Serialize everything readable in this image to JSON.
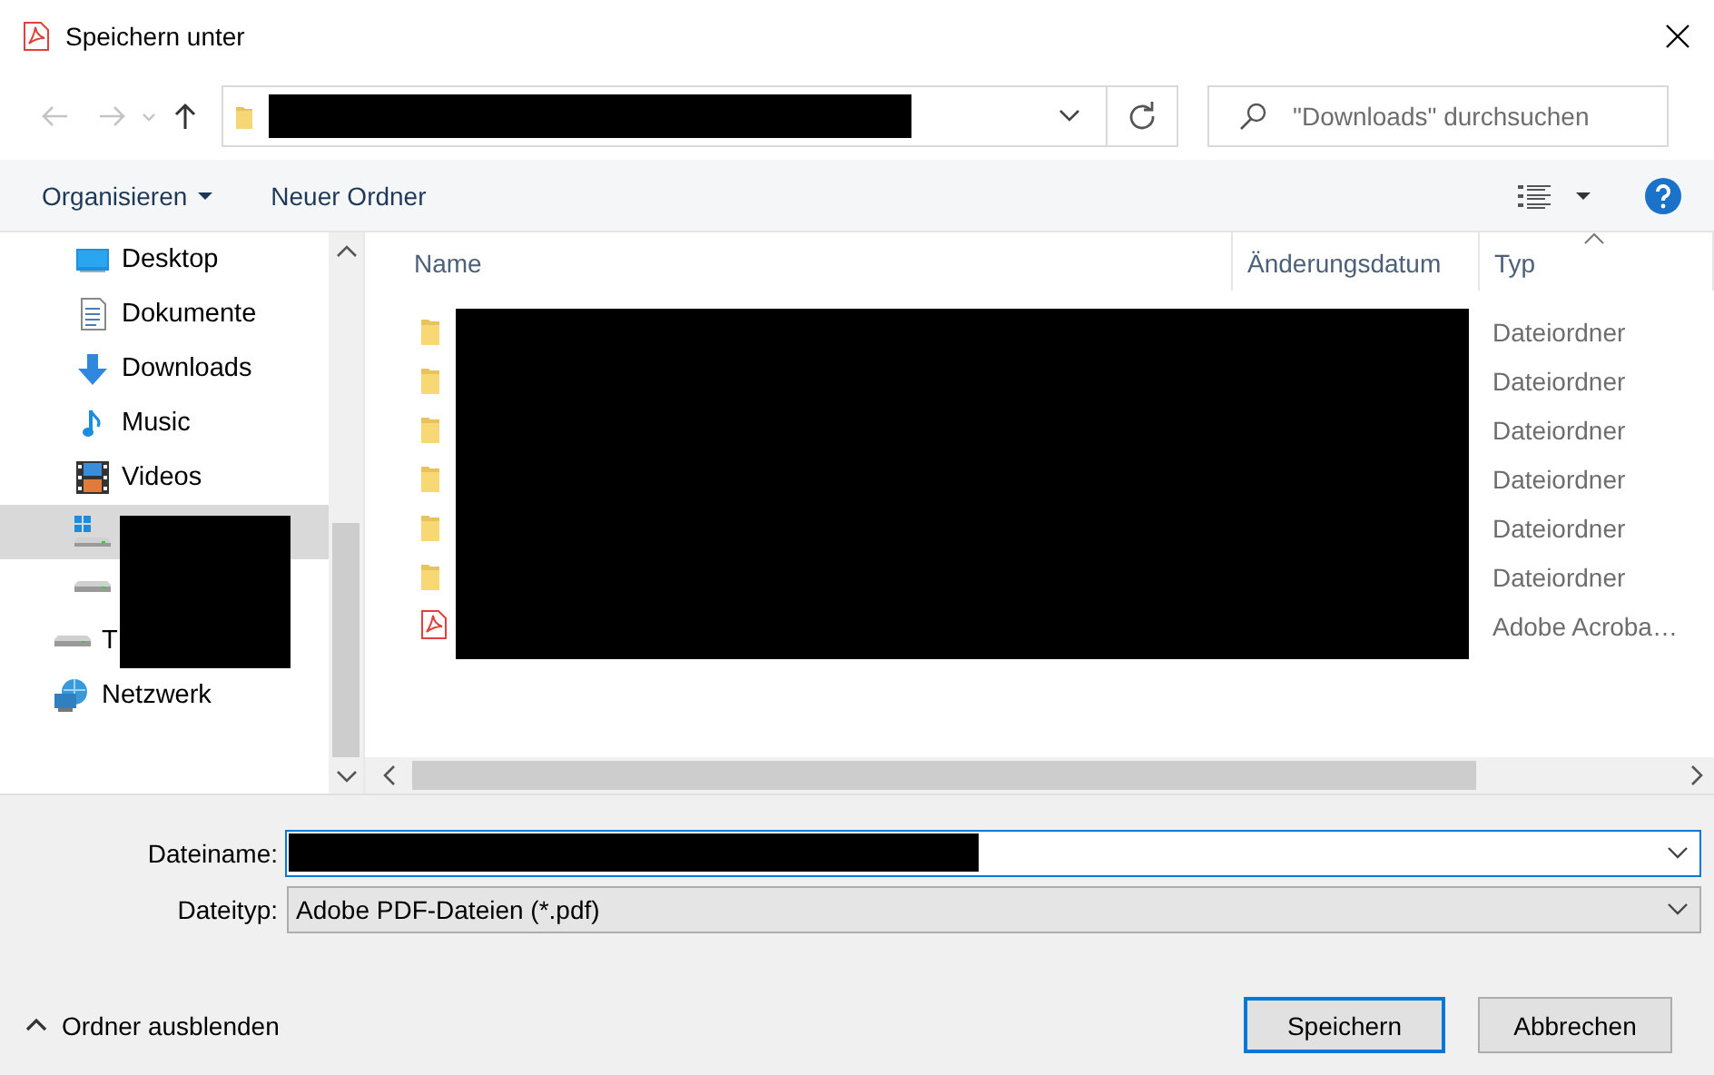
{
  "window": {
    "title": "Speichern unter"
  },
  "navigation": {
    "back": {
      "disabled": true
    },
    "forward": {
      "disabled": true
    },
    "recent": {
      "disabled": true
    },
    "up": {
      "disabled": false
    },
    "address": {
      "redacted": true
    },
    "search": {
      "placeholder": "\"Downloads\" durchsuchen"
    }
  },
  "toolbar": {
    "organize": "Organisieren",
    "new_folder": "Neuer Ordner"
  },
  "sidebar": {
    "children": [
      {
        "kind": "desktop",
        "label": "Desktop",
        "selected": false
      },
      {
        "kind": "documents",
        "label": "Dokumente",
        "selected": false
      },
      {
        "kind": "downloads",
        "label": "Downloads",
        "selected": false
      },
      {
        "kind": "music",
        "label": "Music",
        "selected": false
      },
      {
        "kind": "videos",
        "label": "Videos",
        "selected": false
      },
      {
        "kind": "system-drive",
        "selected": true,
        "redacted": true
      },
      {
        "kind": "drive",
        "selected": false,
        "redacted": true
      }
    ],
    "items": [
      {
        "kind": "drive",
        "label": "T",
        "selected": false,
        "redacted": true
      },
      {
        "kind": "network",
        "label": "Netzwerk",
        "selected": false
      }
    ]
  },
  "file_list": {
    "names_redacted": true,
    "columns": [
      {
        "label": "Name",
        "sorted": false
      },
      {
        "label": "Änderungsdatum",
        "sorted": false
      },
      {
        "label": "Typ",
        "sorted": true
      }
    ],
    "rows": [
      {
        "kind": "folder",
        "type": "Dateiordner"
      },
      {
        "kind": "folder",
        "type": "Dateiordner"
      },
      {
        "kind": "folder",
        "type": "Dateiordner"
      },
      {
        "kind": "folder",
        "type": "Dateiordner"
      },
      {
        "kind": "folder",
        "type": "Dateiordner"
      },
      {
        "kind": "folder",
        "type": "Dateiordner"
      },
      {
        "kind": "pdf",
        "type": "Adobe Acroba…"
      }
    ]
  },
  "form": {
    "filename": {
      "label": "Dateiname:",
      "redacted": true
    },
    "filetype": {
      "label": "Dateityp:",
      "value": "Adobe PDF-Dateien (*.pdf)"
    }
  },
  "footer": {
    "toggle": "Ordner ausblenden",
    "buttons": [
      {
        "label": "Speichern",
        "default": true
      },
      {
        "label": "Abbrechen",
        "default": false
      }
    ]
  }
}
